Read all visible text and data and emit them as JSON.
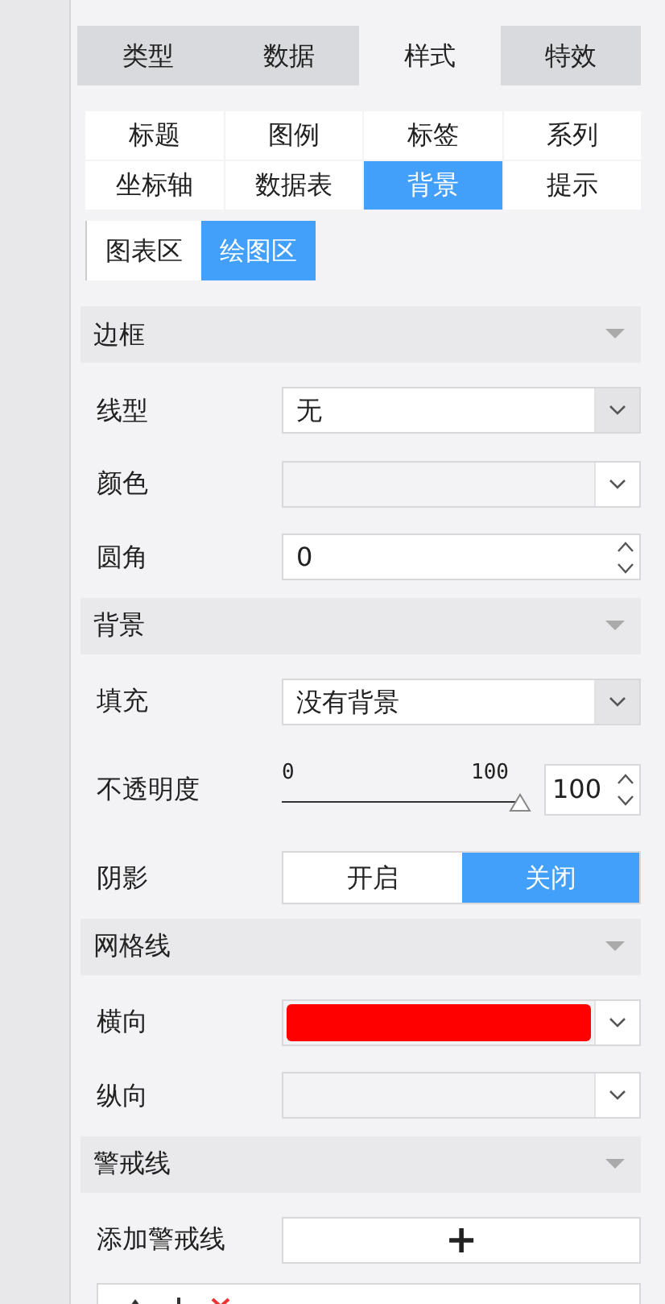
{
  "main_tabs": [
    {
      "label": "类型",
      "selected": false
    },
    {
      "label": "数据",
      "selected": false
    },
    {
      "label": "样式",
      "selected": true
    },
    {
      "label": "特效",
      "selected": false
    }
  ],
  "sub_tabs": [
    {
      "label": "标题",
      "selected": false
    },
    {
      "label": "图例",
      "selected": false
    },
    {
      "label": "标签",
      "selected": false
    },
    {
      "label": "系列",
      "selected": false
    },
    {
      "label": "坐标轴",
      "selected": false
    },
    {
      "label": "数据表",
      "selected": false
    },
    {
      "label": "背景",
      "selected": true
    },
    {
      "label": "提示",
      "selected": false
    }
  ],
  "area_tabs": [
    {
      "label": "图表区",
      "selected": false
    },
    {
      "label": "绘图区",
      "selected": true
    }
  ],
  "sections": [
    {
      "title": "边框",
      "rows": [
        {
          "kind": "select",
          "label": "线型",
          "value": "无"
        },
        {
          "kind": "color",
          "label": "颜色"
        },
        {
          "kind": "spinner",
          "label": "圆角",
          "value": "0"
        }
      ]
    },
    {
      "title": "背景",
      "rows": [
        {
          "kind": "select",
          "label": "填充",
          "value": "没有背景"
        },
        {
          "kind": "slider",
          "label": "不透明度",
          "min_label": "0",
          "max_label": "100",
          "level": 1,
          "value": "100"
        },
        {
          "kind": "toggle",
          "label": "阴影",
          "options": [
            {
              "label": "开启",
              "selected": false
            },
            {
              "label": "关闭",
              "selected": true
            }
          ]
        }
      ]
    },
    {
      "title": "网格线",
      "rows": [
        {
          "kind": "color",
          "label": "横向",
          "color": "#ff0000"
        },
        {
          "kind": "color",
          "label": "纵向"
        }
      ]
    },
    {
      "title": "警戒线",
      "rows": [
        {
          "kind": "add",
          "label": "添加警戒线",
          "button": "+"
        }
      ]
    }
  ]
}
